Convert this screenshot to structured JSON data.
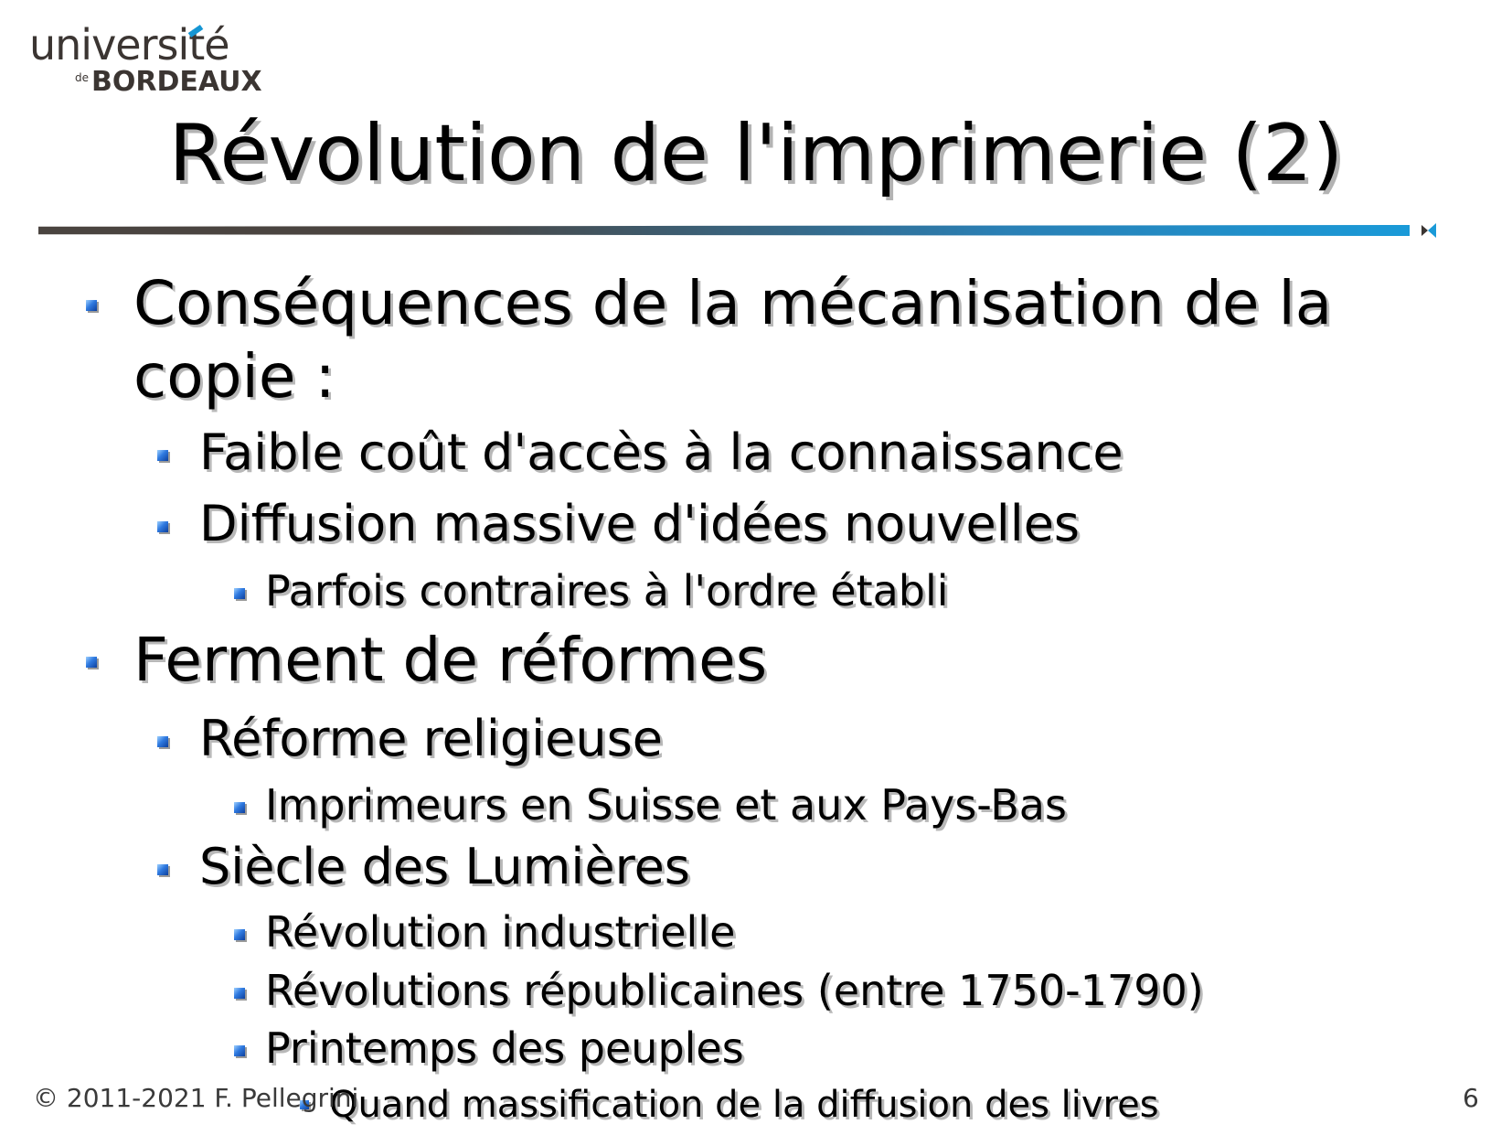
{
  "logo": {
    "top": "université",
    "de": "de",
    "bottom": "BORDEAUX"
  },
  "slide": {
    "title": "Révolution de l'imprimerie (2)",
    "items": [
      "Conséquences de la mécanisation de la",
      "copie :",
      "Faible coût d'accès à la connaissance",
      "Diffusion massive d'idées nouvelles",
      "Parfois contraires à l'ordre établi",
      "Ferment de réformes",
      "Réforme religieuse",
      "Imprimeurs en Suisse et aux Pays-Bas",
      "Siècle des Lumières",
      "Révolution industrielle",
      "Révolutions républicaines (entre 1750-1790)",
      "Printemps des peuples",
      "Quand massification de la diffusion des livres"
    ]
  },
  "footer": {
    "copyright": "© 2011-2021 F. Pellegrini",
    "page_number": "6"
  },
  "colors": {
    "accent": "#1a9ad8",
    "logo_dark": "#3b3532",
    "bullet": "#2f7ae0"
  }
}
